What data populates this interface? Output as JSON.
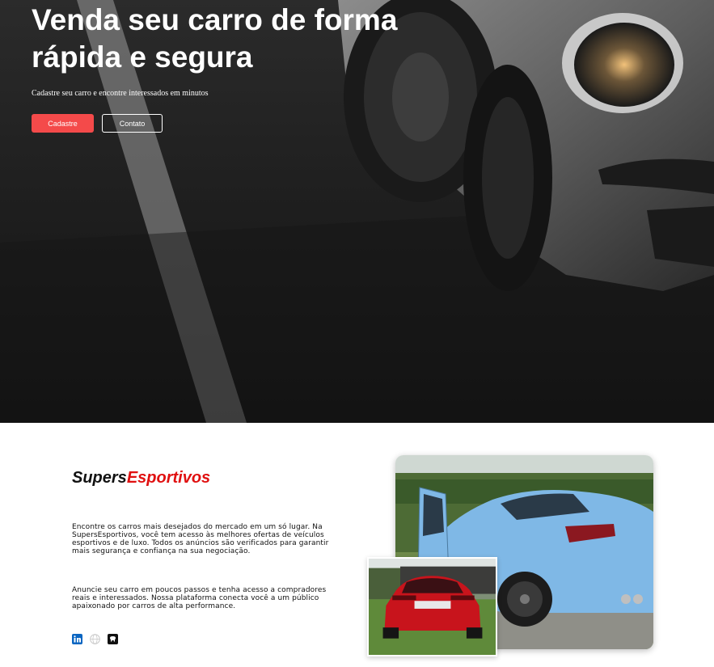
{
  "hero": {
    "title": "Venda seu carro de forma rápida e segura",
    "subtitle": "Cadastre seu carro e encontre interessados em minutos",
    "primary_button": "Cadastre",
    "secondary_button": "Contato"
  },
  "about": {
    "brand_part1": "Supers",
    "brand_part2": "Esportivos",
    "paragraph1": "Encontre os carros mais desejados do mercado em um só lugar. Na SupersEsportivos, você tem acesso às melhores ofertas de veículos esportivos e de luxo. Todos os anúncios são verificados para garantir mais segurança e confiança na sua negociação.",
    "paragraph2": "Anuncie seu carro em poucos passos e tenha acesso a compradores reais e interessados. Nossa plataforma conecta você a um público apaixonado por carros de alta performance."
  },
  "social": [
    "linkedin-icon",
    "globe-icon",
    "github-icon"
  ],
  "colors": {
    "accent": "#f44a4a",
    "brand_red": "#e01010",
    "hero_bg": "#1e1e1e",
    "car_blue": "#7fb8e6",
    "car_red": "#c8141c"
  }
}
